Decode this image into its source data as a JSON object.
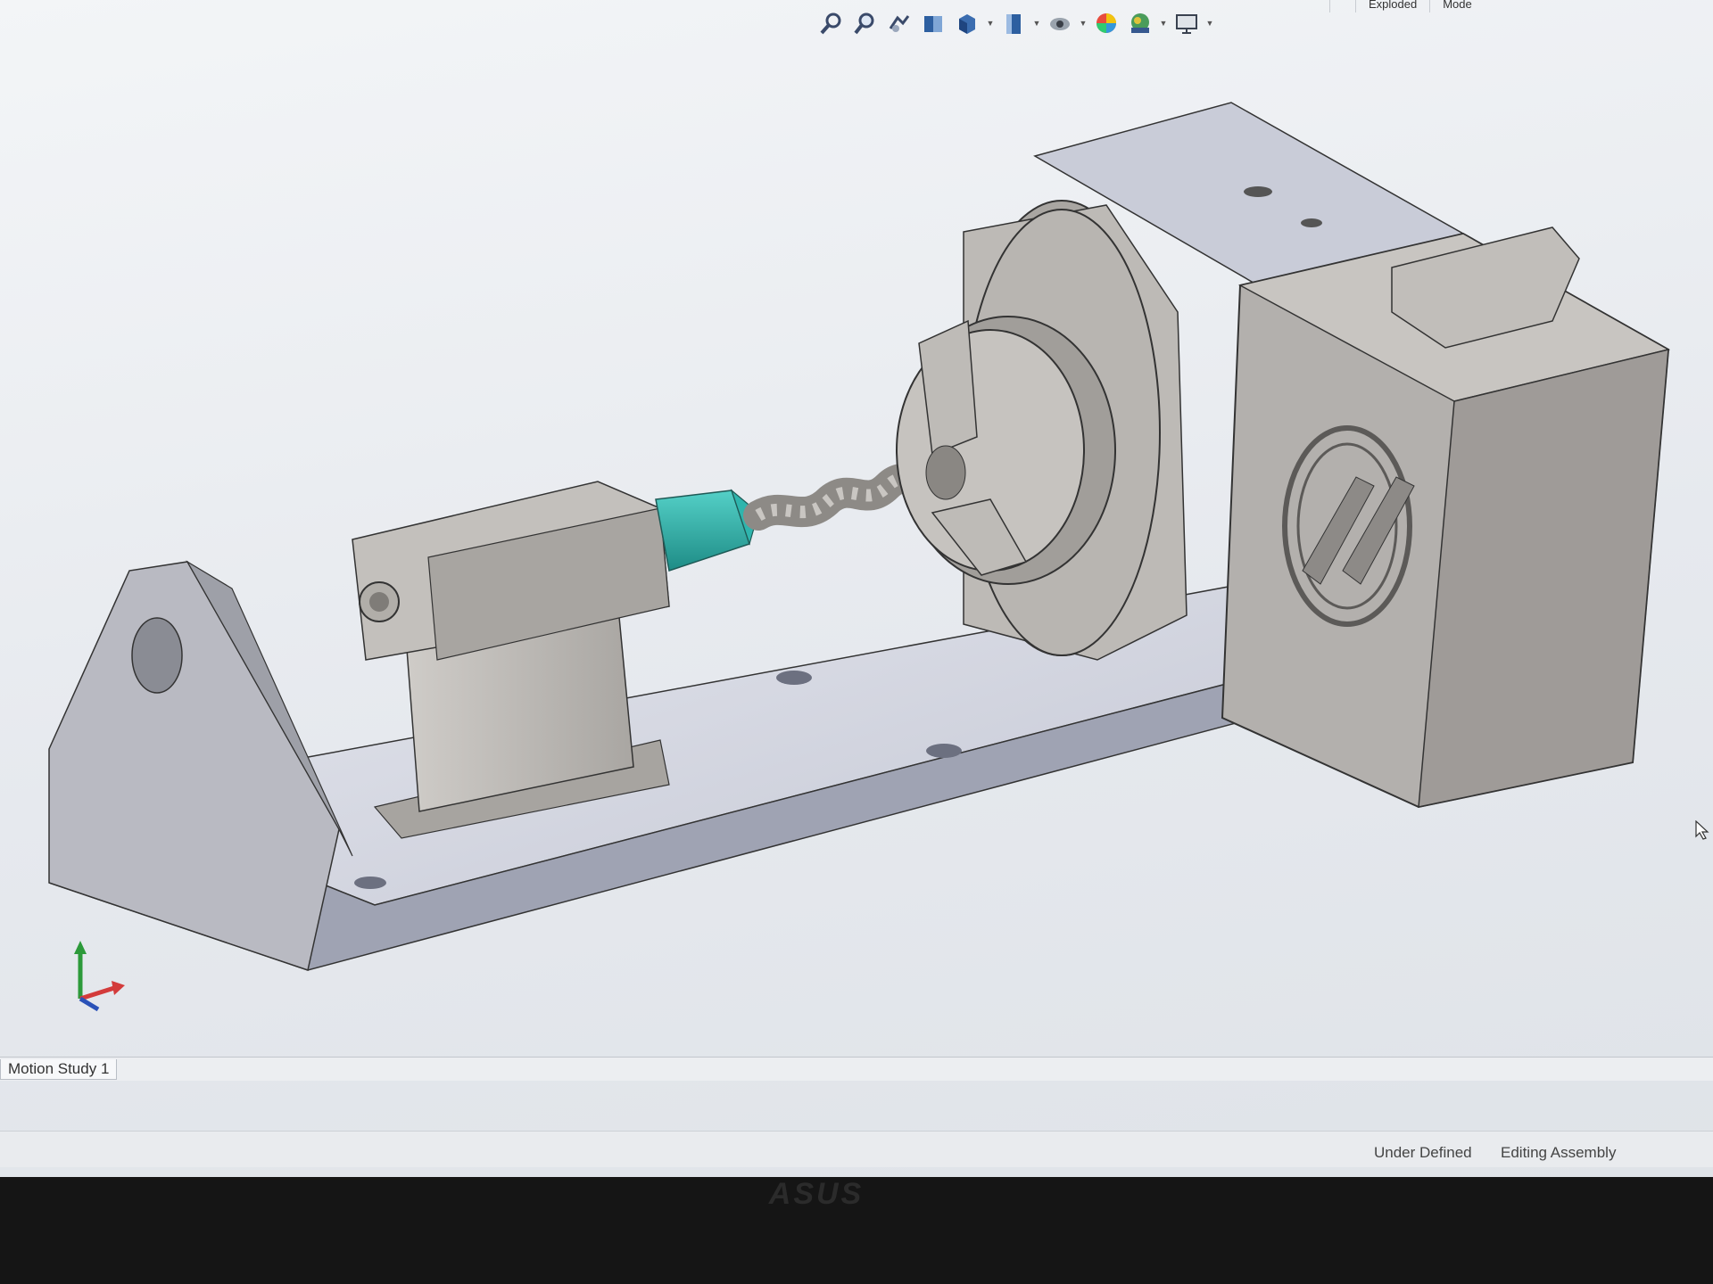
{
  "toolbar": {
    "icons": [
      "zoom-to-fit-icon",
      "zoom-to-area-icon",
      "previous-view-icon",
      "section-view-icon",
      "view-orientation-icon",
      "display-style-icon",
      "hide-show-items-icon",
      "edit-appearance-icon",
      "apply-scene-icon",
      "view-settings-icon"
    ]
  },
  "top_tabs": [
    "",
    "Exploded",
    "Mode"
  ],
  "graphics": {
    "accent_color": "#2fb5ad",
    "part_color": "#b7b4b0",
    "plate_color": "#c7cad6"
  },
  "motion_study": {
    "tab_label": "Motion Study 1"
  },
  "status": {
    "definition": "Under Defined",
    "mode": "Editing Assembly"
  },
  "monitor": {
    "brand": "ASUS"
  }
}
